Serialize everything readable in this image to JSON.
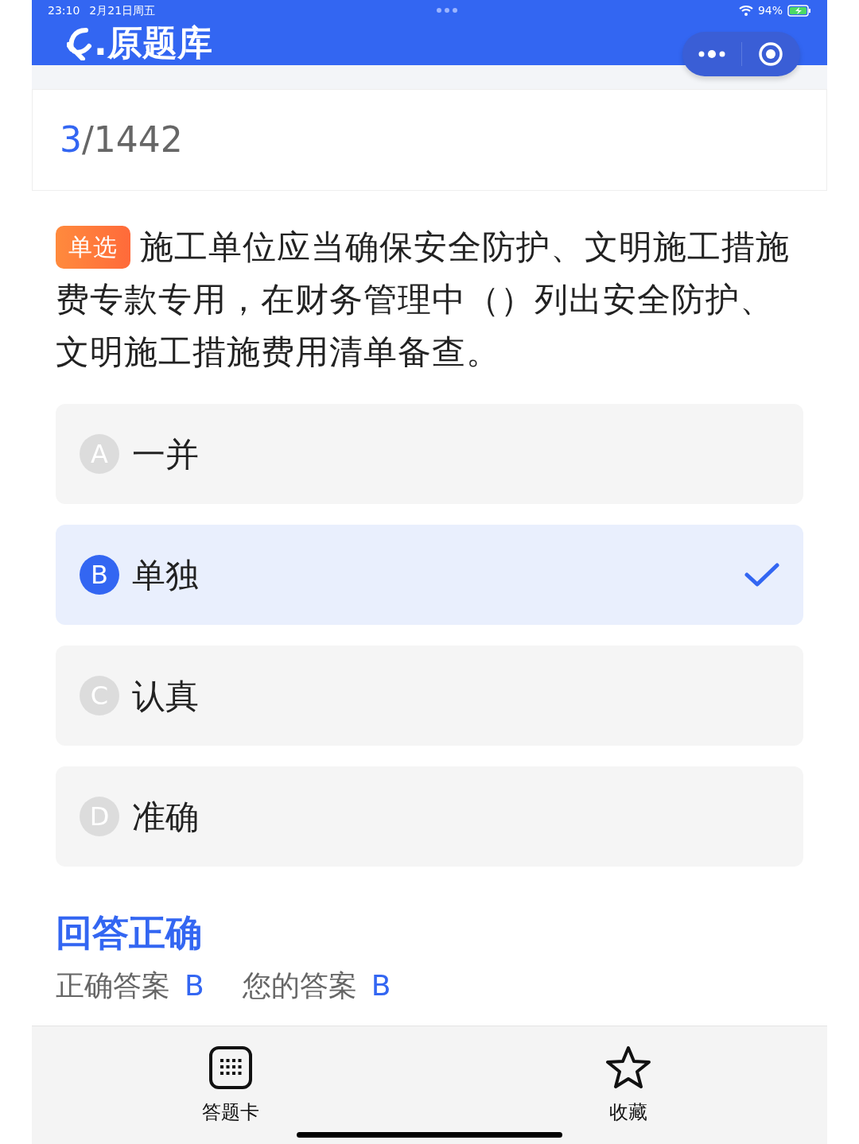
{
  "status_bar": {
    "time": "23:10",
    "date": "2月21日周五",
    "battery": "94%"
  },
  "header": {
    "title": ".原题库"
  },
  "progress": {
    "current": "3",
    "total": "/1442"
  },
  "question": {
    "type_badge": "单选",
    "text": "施工单位应当确保安全防护、文明施工措施费专款专用，在财务管理中（）列出安全防护、文明施工措施费用清单备查。"
  },
  "options": [
    {
      "letter": "A",
      "text": "一并",
      "selected": false
    },
    {
      "letter": "B",
      "text": "单独",
      "selected": true
    },
    {
      "letter": "C",
      "text": "认真",
      "selected": false
    },
    {
      "letter": "D",
      "text": "准确",
      "selected": false
    }
  ],
  "result": {
    "heading": "回答正确",
    "correct_label": "正确答案",
    "correct_value": "B",
    "your_label": "您的答案",
    "your_value": "B"
  },
  "bottom_bar": [
    {
      "kind": "grid",
      "label": "答题卡"
    },
    {
      "kind": "star",
      "label": "收藏"
    }
  ]
}
